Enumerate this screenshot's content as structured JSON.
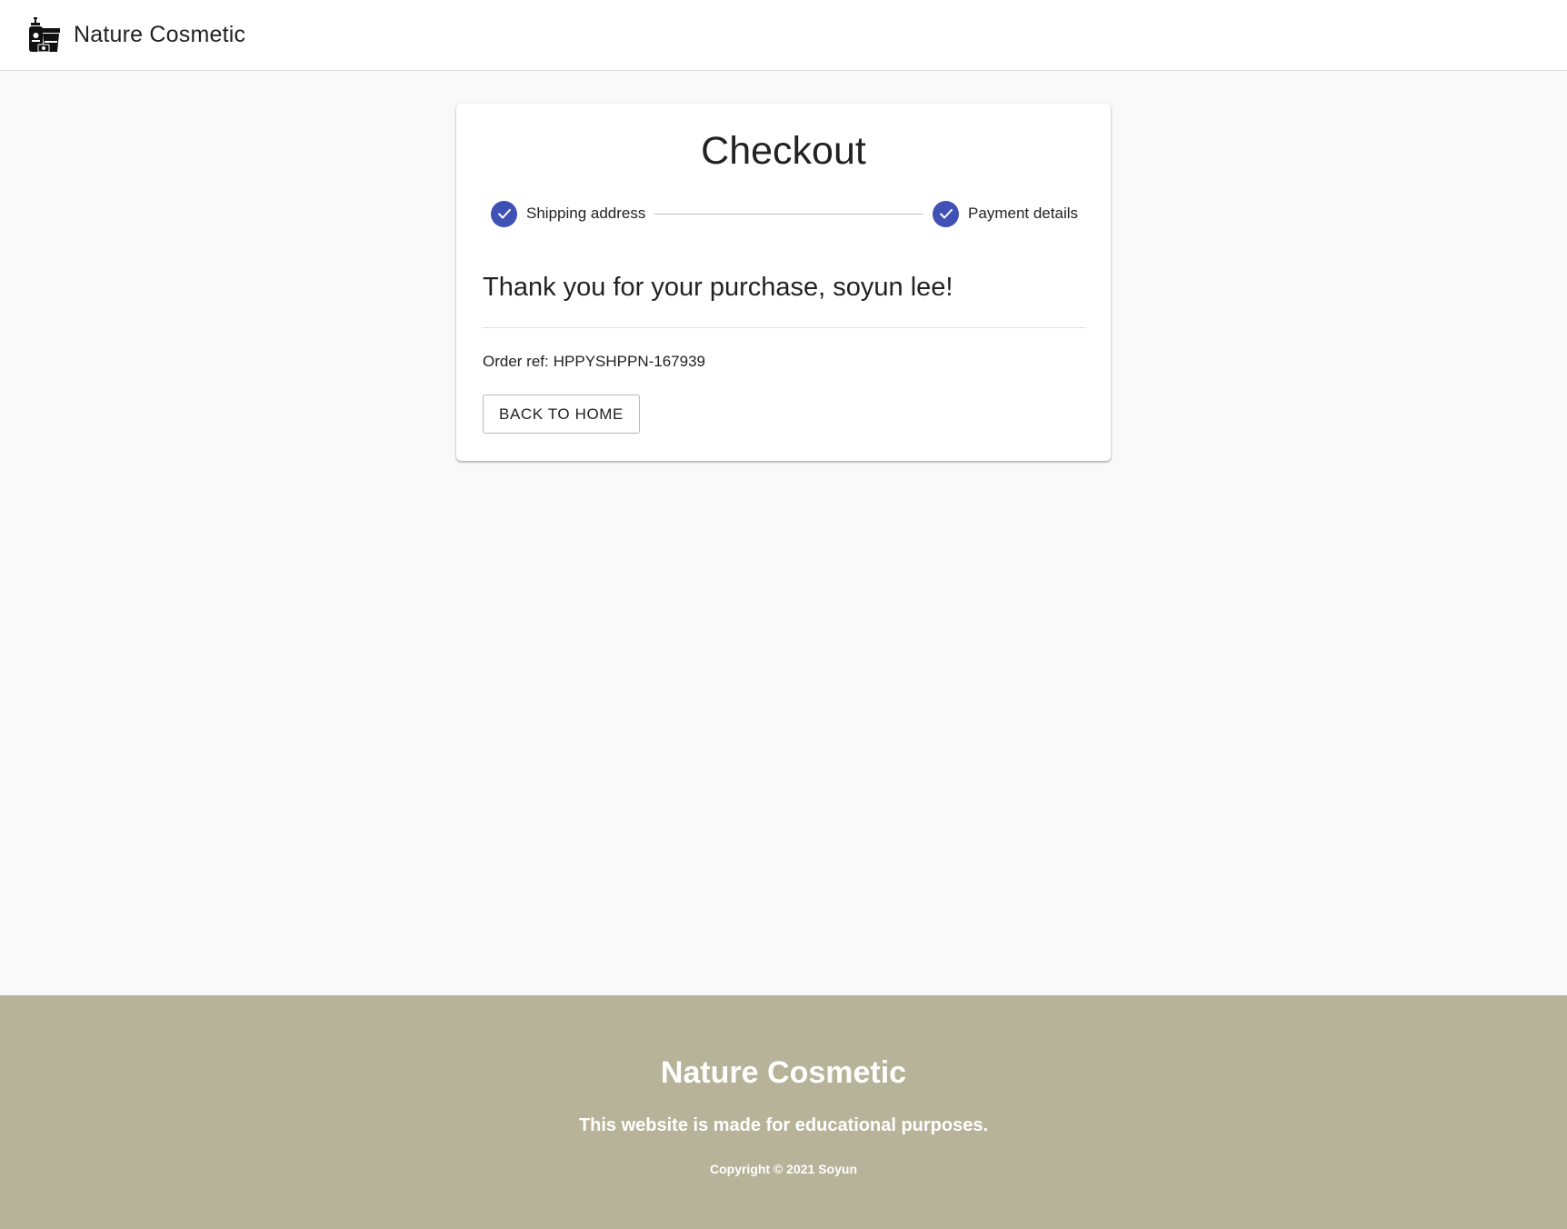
{
  "header": {
    "logo_icon": "cosmetics-logo-icon",
    "title": "Nature Cosmetic"
  },
  "checkout": {
    "title": "Checkout",
    "steps": [
      {
        "label": "Shipping address",
        "status": "completed",
        "icon": "check-icon"
      },
      {
        "label": "Payment details",
        "status": "completed",
        "icon": "check-icon"
      }
    ],
    "thank_you": "Thank you for your purchase, soyun lee!",
    "order_ref_label": "Order ref:",
    "order_ref_value": "HPPYSHPPN-167939",
    "back_button_label": "BACK TO HOME"
  },
  "footer": {
    "title": "Nature Cosmetic",
    "subtitle": "This website is made for educational purposes.",
    "copyright": "Copyright © 2021 Soyun"
  },
  "colors": {
    "accent": "#3f51b5",
    "footer_bg": "#b7b399",
    "page_bg": "#f9f9f9"
  }
}
